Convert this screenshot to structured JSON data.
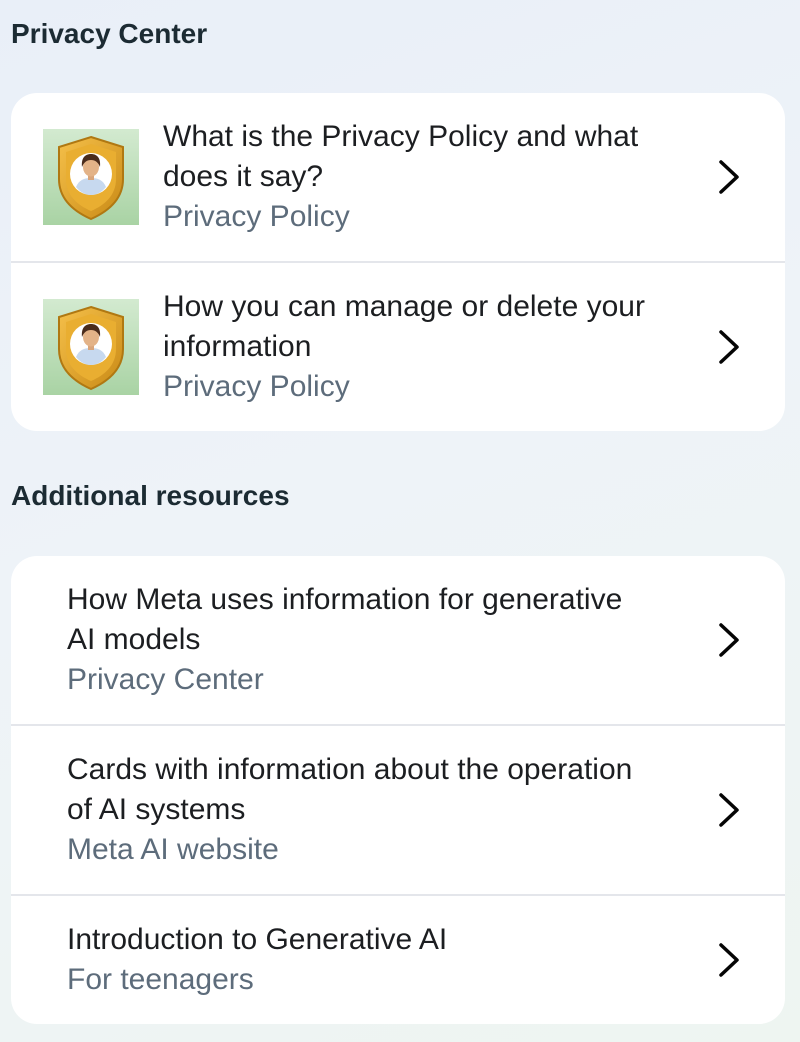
{
  "privacy_center": {
    "title": "Privacy Center",
    "items": [
      {
        "title_line1": "What is the Privacy Policy and what",
        "title_line2": "does it say?",
        "subtitle": "Privacy Policy",
        "icon": "privacy-shield-person-icon"
      },
      {
        "title_line1": "How you can manage or delete your",
        "title_line2": "information",
        "subtitle": "Privacy Policy",
        "icon": "privacy-shield-person-icon"
      }
    ]
  },
  "additional_resources": {
    "title": "Additional resources",
    "items": [
      {
        "title_line1": "How Meta uses information for generative",
        "title_line2": "AI models",
        "subtitle": "Privacy Center"
      },
      {
        "title_line1": "Cards with information about the operation",
        "title_line2": "of AI systems",
        "subtitle": "Meta AI website"
      },
      {
        "title_line1": "Introduction to Generative AI",
        "subtitle": "For teenagers"
      }
    ]
  },
  "colors": {
    "card_background": "#ffffff",
    "subtitle_text": "#5d6c7b",
    "shield_gold": "#e2a92b",
    "thumb_green": "#b9dcb3"
  },
  "icons": {
    "chevron": "chevron-right-icon",
    "thumbnail": "privacy-shield-person-icon"
  }
}
